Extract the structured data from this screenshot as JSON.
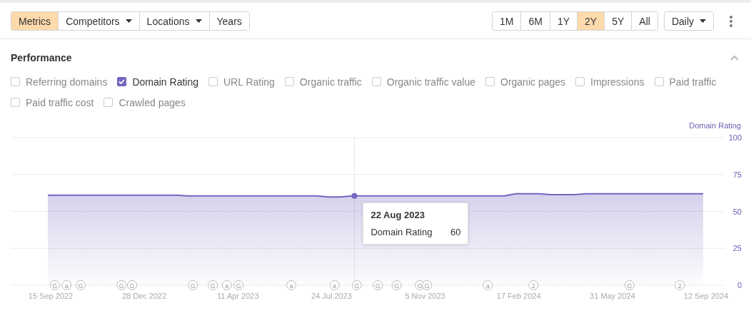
{
  "toolbar": {
    "left_buttons": [
      {
        "label": "Metrics",
        "selected": true,
        "dropdown": false
      },
      {
        "label": "Competitors",
        "selected": false,
        "dropdown": true
      },
      {
        "label": "Locations",
        "selected": false,
        "dropdown": true
      },
      {
        "label": "Years",
        "selected": false,
        "dropdown": false
      }
    ],
    "ranges": [
      {
        "label": "1M",
        "selected": false
      },
      {
        "label": "6M",
        "selected": false
      },
      {
        "label": "1Y",
        "selected": false
      },
      {
        "label": "2Y",
        "selected": true
      },
      {
        "label": "5Y",
        "selected": false
      },
      {
        "label": "All",
        "selected": false
      }
    ],
    "interval": "Daily"
  },
  "section": {
    "title": "Performance",
    "expanded": true
  },
  "metrics": [
    {
      "label": "Referring domains",
      "checked": false
    },
    {
      "label": "Domain Rating",
      "checked": true
    },
    {
      "label": "URL Rating",
      "checked": false
    },
    {
      "label": "Organic traffic",
      "checked": false
    },
    {
      "label": "Organic traffic value",
      "checked": false
    },
    {
      "label": "Organic pages",
      "checked": false
    },
    {
      "label": "Impressions",
      "checked": false
    },
    {
      "label": "Paid traffic",
      "checked": false
    },
    {
      "label": "Paid traffic cost",
      "checked": false
    },
    {
      "label": "Crawled pages",
      "checked": false
    }
  ],
  "chart_data": {
    "type": "area",
    "ylabel": "Domain Rating",
    "categories": [
      "15 Sep 2022",
      null,
      null,
      null,
      null,
      null,
      null,
      null,
      "28 Dec 2022",
      null,
      null,
      null,
      null,
      null,
      null,
      null,
      "11 Apr 2023",
      null,
      null,
      null,
      null,
      null,
      null,
      null,
      "24 Jul 2023",
      null,
      null,
      null,
      null,
      null,
      null,
      null,
      "5 Nov 2023",
      null,
      null,
      null,
      null,
      null,
      null,
      null,
      "17 Feb 2024",
      null,
      null,
      null,
      null,
      null,
      null,
      null,
      "31 May 2024",
      null,
      null,
      null,
      null,
      null,
      null,
      null,
      "12 Sep 2024"
    ],
    "series": [
      {
        "name": "Domain Rating",
        "color": "#7466c0",
        "values": [
          61,
          61,
          61,
          61,
          61,
          61,
          61,
          61,
          61,
          61,
          61,
          61,
          60.5,
          60.5,
          60.5,
          60.5,
          60.5,
          60.5,
          60.5,
          60.5,
          60.5,
          60.5,
          60.5,
          60.5,
          59.8,
          59.8,
          60.5,
          60.5,
          60.5,
          60.5,
          60.5,
          60.5,
          60.5,
          60.5,
          60.5,
          60.5,
          60.5,
          60.5,
          60.5,
          60.5,
          62,
          62,
          62,
          61.3,
          61.3,
          61.3,
          62,
          62,
          62,
          62,
          62,
          62,
          62,
          62,
          62,
          62,
          62
        ]
      }
    ],
    "ylim": [
      0,
      100
    ],
    "grid": true,
    "yticks": [
      0,
      25,
      50,
      75,
      100
    ],
    "annotations": [
      "G",
      "a",
      "G",
      "G",
      "G",
      "G",
      "G",
      "a",
      "G",
      "a",
      "a",
      "G",
      "G",
      "G",
      "G",
      "G",
      "a",
      "2",
      "G",
      "2"
    ]
  },
  "tooltip": {
    "date": "22 Aug 2023",
    "value": "60"
  }
}
